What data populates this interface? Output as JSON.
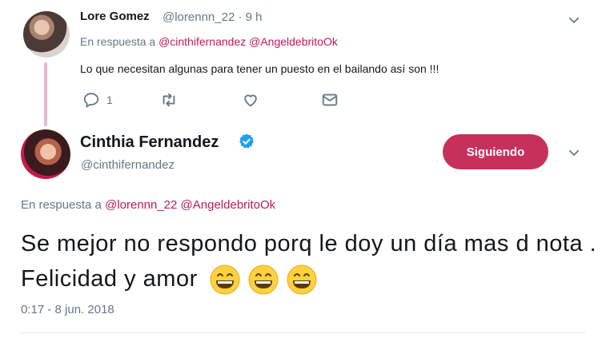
{
  "reply_tweet": {
    "name": "Lore Gomez",
    "handle_time": "@lorennn_22 · 9 h",
    "reply_prefix": "En respuesta a",
    "reply_mentions": "@cinthifernandez @AngeldebritoOk",
    "text": "Lo que necesitan algunas para tener un puesto en el bailando así son !!!",
    "reply_count": "1"
  },
  "main_tweet": {
    "name": "Cinthia Fernandez",
    "handle": "@cinthifernandez",
    "follow_label": "Siguiendo",
    "reply_prefix": "En respuesta a",
    "reply_mentions": "@lorennn_22 @AngeldebritoOk",
    "text": "Se mejor no respondo porq le doy un día mas d nota . Felicidad y amor",
    "timestamp": "0:17 - 8 jun. 2018"
  },
  "icons": [
    "reply-icon",
    "retweet-icon",
    "like-icon",
    "message-icon",
    "chevron-down-icon",
    "verified-badge-icon",
    "grinning-emoji-icon"
  ],
  "colors": {
    "accent": "#c7305b",
    "mention": "#c2185b",
    "muted": "#657786",
    "verified": "#1da1f2",
    "thread": "#e4b9d1"
  }
}
